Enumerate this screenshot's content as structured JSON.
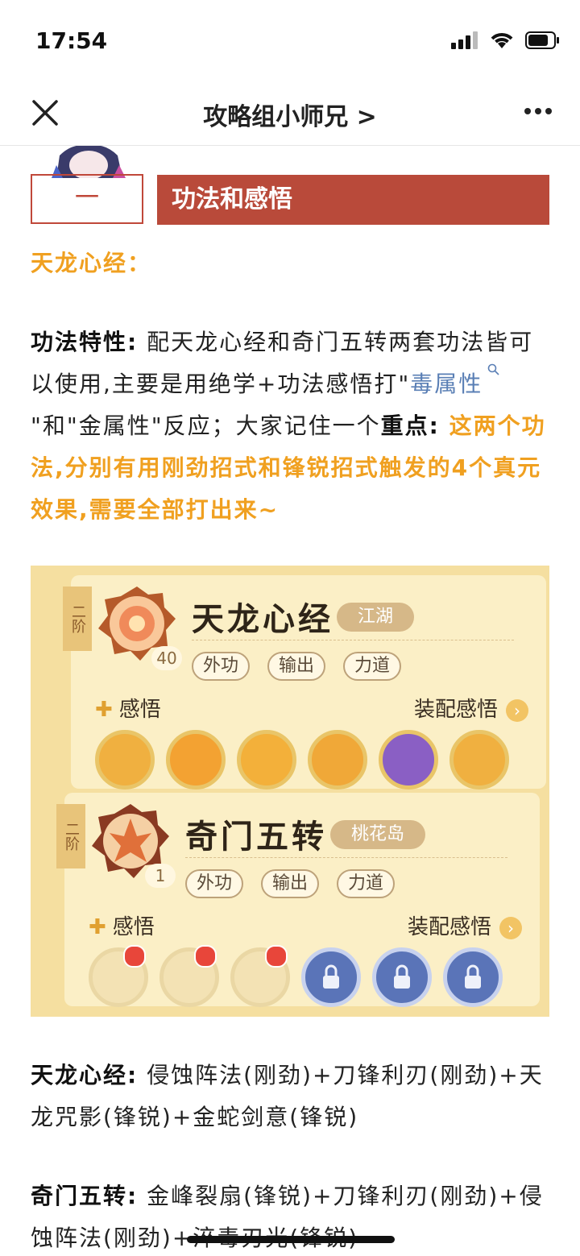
{
  "status_bar": {
    "time": "17:54"
  },
  "navbar": {
    "title": "攻略组小师兄 >"
  },
  "section": {
    "number": "一",
    "title": "功法和感悟"
  },
  "paragraph1": {
    "heading": "天龙心经："
  },
  "paragraph2": {
    "label": "功法特性:",
    "text_a": " 配天龙心经和奇门五转两套功法皆可以使用,主要是用绝学+功法感悟打\"",
    "link": "毒属性",
    "text_b": "\"和\"金属性\"反应；大家记住一个",
    "key_label": "重点:",
    "highlight": " 这两个功法,分别有用刚劲招式和锋锐招式触发的4个真元效果,需要全部打出来~"
  },
  "game_screenshot": {
    "cards": [
      {
        "tier": "二阶",
        "level": "40",
        "name": "天龙心经",
        "sect": "江湖",
        "tags": [
          "外功",
          "输出",
          "力道"
        ],
        "wisdom_label": "感悟",
        "equip_label": "装配感悟",
        "slot_colors": [
          "#f0b040",
          "#f3a232",
          "#f3b03a",
          "#f0a838",
          "#8a5fc4",
          "#f0b040"
        ]
      },
      {
        "tier": "二阶",
        "level": "1",
        "name": "奇门五转",
        "sect": "桃花岛",
        "tags": [
          "外功",
          "输出",
          "力道"
        ],
        "wisdom_label": "感悟",
        "equip_label": "装配感悟"
      }
    ]
  },
  "paragraph3": {
    "label": "天龙心经:",
    "text": " 侵蚀阵法(刚劲)+刀锋利刃(刚劲)+天龙咒影(锋锐)+金蛇剑意(锋锐)"
  },
  "paragraph4": {
    "label": "奇门五转:",
    "text": " 金峰裂扇(锋锐)+刀锋利刃(刚劲)+侵蚀阵法(刚劲)+淬毒刃光(锋锐)"
  }
}
